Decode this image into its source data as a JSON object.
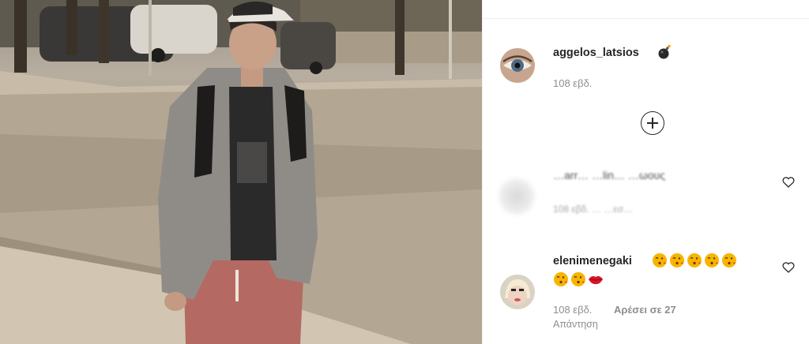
{
  "post": {
    "author": {
      "username": "aggelos_latsios",
      "badge_icon": "bomb-icon",
      "time_ago": "108 εβδ."
    },
    "load_more_icon": "plus-circle-icon"
  },
  "comments": [
    {
      "username": "",
      "text_partial": "…arr… …lin… …ωους",
      "meta_partial": "108 εβδ.  …  …εσ…",
      "hidden": true
    },
    {
      "username": "elenimenegaki",
      "emojis": [
        "kiss-face",
        "kiss-face",
        "kiss-face",
        "kiss-face",
        "kiss-face",
        "kiss-face",
        "kiss-face",
        "lips"
      ],
      "time_ago": "108 εβδ.",
      "likes_label": "Αρέσει σε 27",
      "reply_label": "Απάντηση"
    }
  ],
  "colors": {
    "text": "#262626",
    "muted": "#8e8e8e",
    "divider": "#efefef",
    "emoji_face": "#f7b500",
    "lips": "#d9142a"
  }
}
